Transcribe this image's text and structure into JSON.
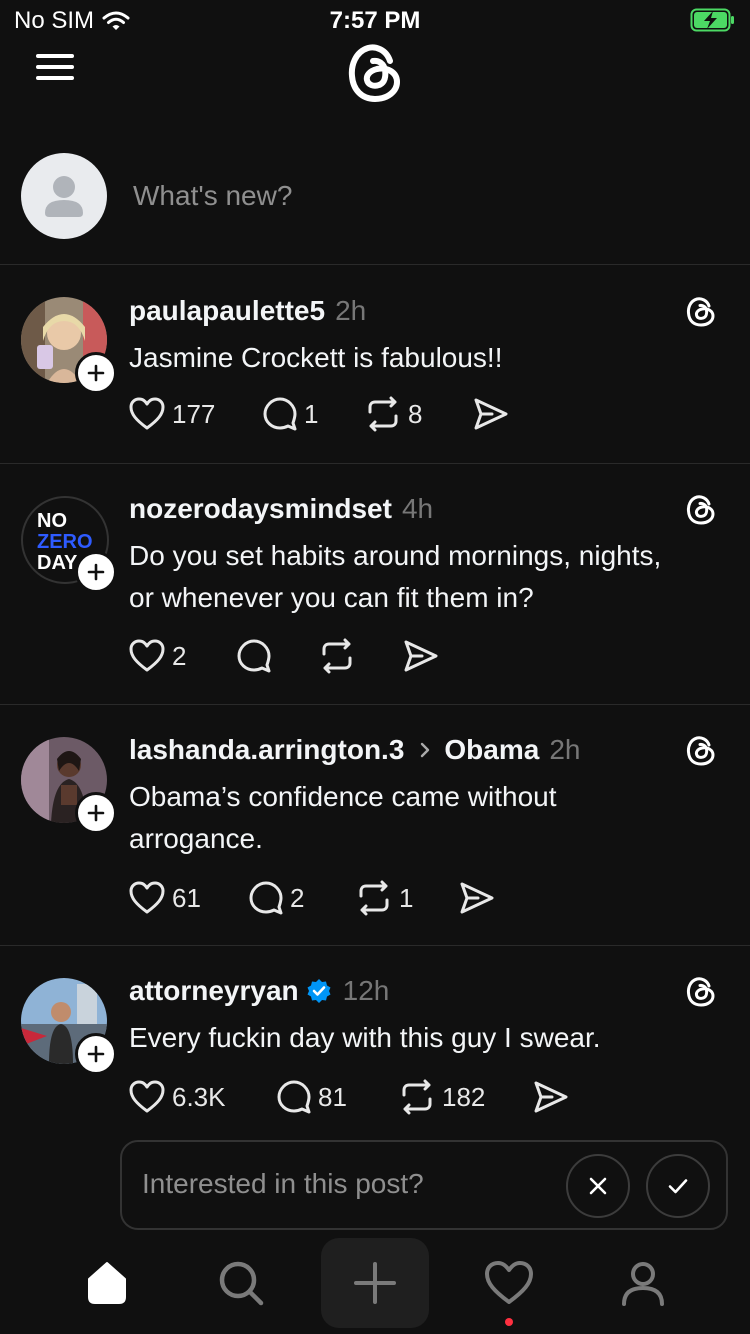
{
  "status_bar": {
    "carrier": "No SIM",
    "time": "7:57 PM"
  },
  "composer": {
    "placeholder": "What's new?"
  },
  "posts": [
    {
      "username": "paulapaulette5",
      "time": "2h",
      "text": "Jasmine Crockett is fabulous!!",
      "likes": "177",
      "replies": "1",
      "reposts": "8"
    },
    {
      "username": "nozerodaysmindset",
      "time": "4h",
      "text_lines": [
        "Do you set habits around mornings, nights,",
        "or whenever you can fit them in?"
      ],
      "likes": "2",
      "replies": "",
      "reposts": "",
      "avatar_lines": [
        "NO",
        "ZERO",
        "DAY"
      ]
    },
    {
      "username": "lashanda.arrington.3",
      "community": "Obama",
      "time": "2h",
      "text_lines": [
        "Obama’s confidence came without",
        "arrogance."
      ],
      "likes": "61",
      "replies": "2",
      "reposts": "1"
    },
    {
      "username": "attorneyryan",
      "verified": true,
      "time": "12h",
      "text": "Every fuckin day with this guy I swear.",
      "likes": "6.3K",
      "replies": "81",
      "reposts": "182"
    }
  ],
  "interest_prompt": {
    "text": "Interested in this post?"
  },
  "colors": {
    "background": "#101010",
    "text": "#f3f5f7",
    "muted": "#777777",
    "verified": "#0095f6",
    "notification": "#ff3040"
  }
}
